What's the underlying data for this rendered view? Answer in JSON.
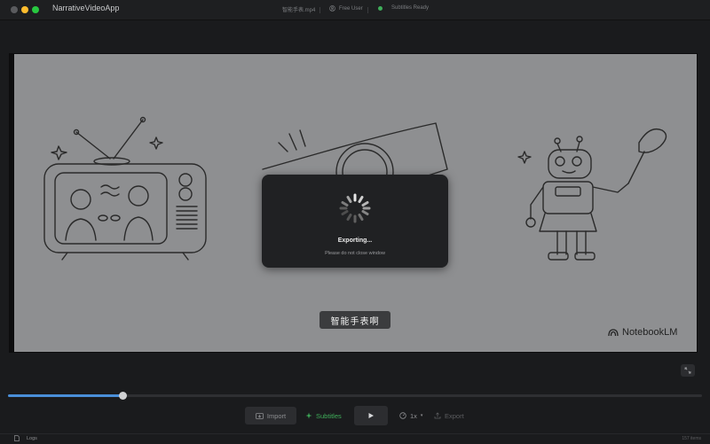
{
  "window": {
    "app_title": "NarrativeVideoApp",
    "file_name": "智能手表.mp4",
    "user_label": "Free User",
    "subtitles_status": "Subtitles Ready"
  },
  "video": {
    "subtitle_text": "智能手表啊",
    "watermark": "NotebookLM"
  },
  "export_modal": {
    "title": "Exporting...",
    "subtitle": "Please do not close window"
  },
  "playback": {
    "progress": 0.165
  },
  "controls": {
    "import_label": "Import",
    "subtitles_label": "Subtitles",
    "speed_label": "1x",
    "export_label": "Export"
  },
  "footer": {
    "logs_label": "Logs",
    "right_text": "157 items"
  },
  "colors": {
    "accent_green": "#3fae5a",
    "progress_blue": "#4a8fd9",
    "traffic_yellow": "#febc2e",
    "traffic_green": "#28c840"
  },
  "icons": [
    "import-icon",
    "subtitles-icon",
    "play-icon",
    "speed-icon",
    "export-icon",
    "user-icon",
    "logs-icon",
    "fullscreen-icon",
    "notebooklm-icon"
  ]
}
